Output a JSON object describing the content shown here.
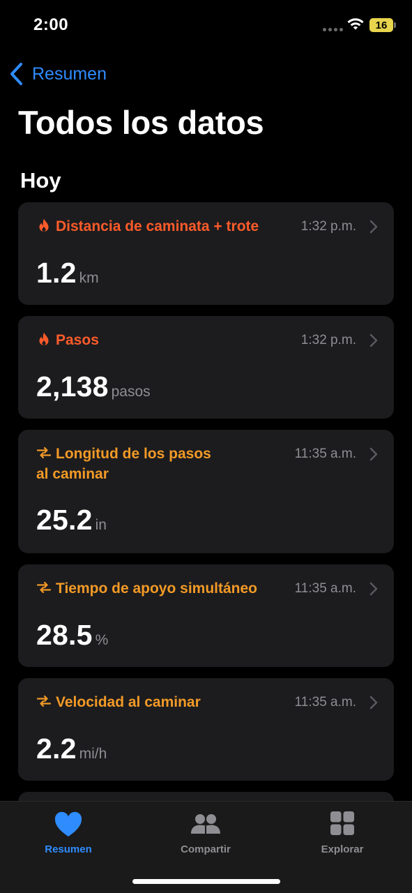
{
  "status_bar": {
    "time": "2:00",
    "battery_level": "16"
  },
  "nav": {
    "back_label": "Resumen"
  },
  "page": {
    "title": "Todos los datos",
    "section": "Hoy"
  },
  "cards": [
    {
      "icon": "flame-icon",
      "title": "Distancia de caminata + trote",
      "time": "1:32 p.m.",
      "value": "1.2",
      "unit": "km"
    },
    {
      "icon": "flame-icon",
      "title": "Pasos",
      "time": "1:32 p.m.",
      "value": "2,138",
      "unit": "pasos"
    },
    {
      "icon": "mobility-arrows-icon",
      "title_line1": "Longitud de los pasos",
      "title_line2": "al caminar",
      "time": "11:35 a.m.",
      "value": "25.2",
      "unit": "in"
    },
    {
      "icon": "mobility-arrows-icon",
      "title": "Tiempo de apoyo simultáneo",
      "time": "11:35 a.m.",
      "value": "28.5",
      "unit": "%"
    },
    {
      "icon": "mobility-arrows-icon",
      "title": "Velocidad al caminar",
      "time": "11:35 a.m.",
      "value": "2.2",
      "unit": "mi/h"
    }
  ],
  "tab_bar": {
    "tabs": [
      {
        "label": "Resumen",
        "icon": "heart-icon",
        "active": true
      },
      {
        "label": "Compartir",
        "icon": "people-icon",
        "active": false
      },
      {
        "label": "Explorar",
        "icon": "grid-icon",
        "active": false
      }
    ]
  },
  "colors": {
    "accent": "#2f8cff",
    "activity": "#fe5b2a",
    "mobility": "#f39a27",
    "card": "#1c1c1e"
  }
}
